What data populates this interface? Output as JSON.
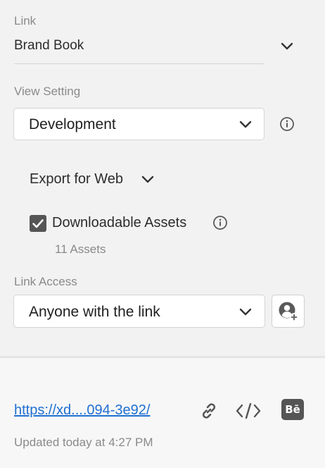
{
  "link": {
    "label": "Link",
    "value": "Brand Book"
  },
  "view_setting": {
    "label": "View Setting",
    "selected": "Development"
  },
  "export": {
    "label": "Export for Web"
  },
  "downloadable": {
    "label": "Downloadable Assets",
    "checked": true,
    "count": "11 Assets"
  },
  "link_access": {
    "label": "Link Access",
    "selected": "Anyone with the link"
  },
  "footer": {
    "url": "https://xd....094-3e92/",
    "updated": "Updated today at 4:27 PM",
    "behance_glyph": "Bē"
  },
  "colors": {
    "link_blue": "#1f6fd1",
    "checkbox": "#555555"
  },
  "icons": [
    "chevron-down-icon",
    "info-icon",
    "checkmark-icon",
    "invite-user-icon",
    "copy-link-icon",
    "embed-code-icon",
    "behance-icon"
  ]
}
